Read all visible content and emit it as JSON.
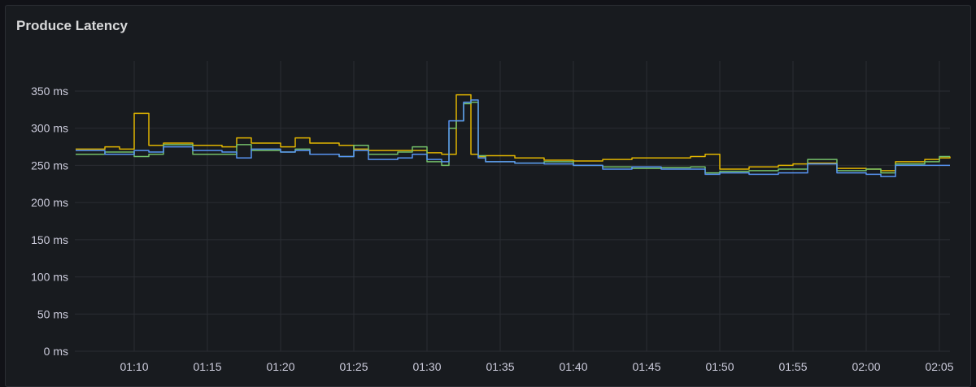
{
  "panel": {
    "title": "Produce Latency"
  },
  "chart_data": {
    "type": "line",
    "title": "Produce Latency",
    "xlabel": "",
    "ylabel": "",
    "y_unit": "ms",
    "ylim": [
      0,
      380
    ],
    "xlim": [
      "01:06",
      "02:06"
    ],
    "grid": true,
    "legend": "none",
    "x_ticks": [
      "01:10",
      "01:15",
      "01:20",
      "01:25",
      "01:30",
      "01:35",
      "01:40",
      "01:45",
      "01:50",
      "01:55",
      "02:00",
      "02:05"
    ],
    "y_ticks": [
      "0 ms",
      "50 ms",
      "100 ms",
      "150 ms",
      "200 ms",
      "250 ms",
      "300 ms",
      "350 ms"
    ],
    "x": [
      "01:06",
      "01:08",
      "01:09",
      "01:10",
      "01:11",
      "01:12",
      "01:14",
      "01:16",
      "01:17",
      "01:18",
      "01:20",
      "01:21",
      "01:22",
      "01:24",
      "01:25",
      "01:26",
      "01:28",
      "01:29",
      "01:30",
      "01:31",
      "01:31:30",
      "01:32",
      "01:32:30",
      "01:33",
      "01:33:30",
      "01:34",
      "01:36",
      "01:38",
      "01:40",
      "01:42",
      "01:44",
      "01:46",
      "01:48",
      "01:49",
      "01:50",
      "01:52",
      "01:54",
      "01:55",
      "01:56",
      "01:58",
      "02:00",
      "02:01",
      "02:02",
      "02:04",
      "02:05",
      "02:06"
    ],
    "series": [
      {
        "color": "#e0b400",
        "values": [
          272,
          275,
          272,
          320,
          277,
          280,
          277,
          275,
          287,
          280,
          275,
          287,
          280,
          277,
          272,
          270,
          270,
          270,
          267,
          265,
          265,
          345,
          345,
          265,
          262,
          263,
          260,
          257,
          256,
          258,
          260,
          260,
          262,
          265,
          245,
          248,
          250,
          252,
          253,
          246,
          245,
          243,
          255,
          258,
          260,
          262
        ]
      },
      {
        "color": "#73bf69",
        "values": [
          265,
          268,
          268,
          262,
          265,
          278,
          265,
          265,
          278,
          270,
          268,
          272,
          265,
          262,
          277,
          265,
          268,
          275,
          255,
          250,
          300,
          310,
          333,
          335,
          263,
          255,
          253,
          255,
          250,
          248,
          246,
          247,
          248,
          240,
          242,
          243,
          245,
          245,
          258,
          243,
          245,
          240,
          252,
          255,
          262,
          262
        ]
      },
      {
        "color": "#5794f2",
        "values": [
          270,
          265,
          265,
          270,
          268,
          275,
          270,
          268,
          260,
          272,
          268,
          270,
          265,
          262,
          270,
          258,
          260,
          265,
          258,
          255,
          310,
          310,
          335,
          338,
          260,
          255,
          253,
          252,
          250,
          245,
          248,
          245,
          245,
          238,
          240,
          238,
          240,
          240,
          252,
          240,
          238,
          235,
          250,
          250,
          250,
          250
        ]
      }
    ]
  }
}
